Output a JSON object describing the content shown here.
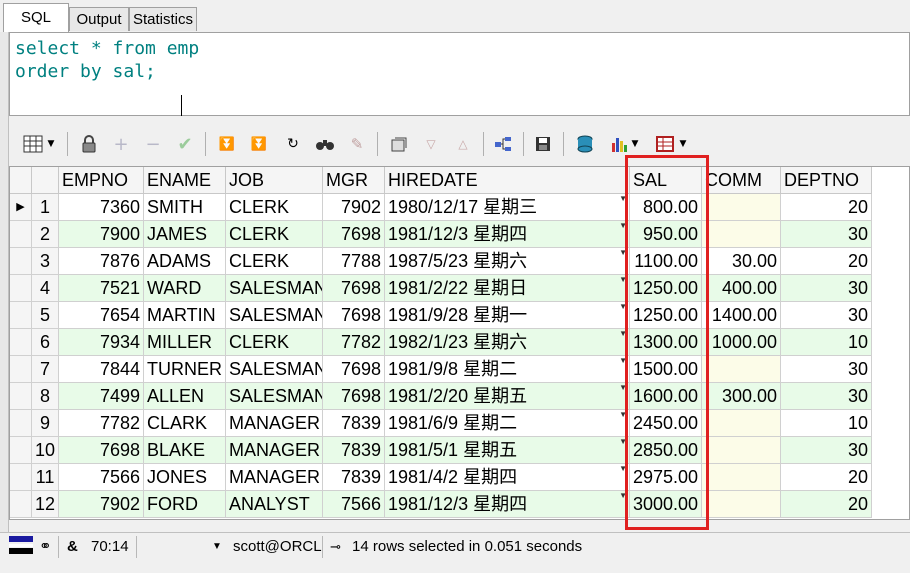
{
  "tabs": [
    {
      "label": "SQL",
      "active": true
    },
    {
      "label": "Output",
      "active": false
    },
    {
      "label": "Statistics",
      "active": false
    }
  ],
  "editor": {
    "line1": "select * from emp",
    "line2": "order by sal;"
  },
  "grid": {
    "columns": [
      "EMPNO",
      "ENAME",
      "JOB",
      "MGR",
      "HIREDATE",
      "SAL",
      "COMM",
      "DEPTNO"
    ],
    "rows": [
      {
        "n": "1",
        "empno": "7360",
        "ename": "SMITH",
        "job": "CLERK",
        "mgr": "7902",
        "hiredate": "1980/12/17 星期三",
        "sal": "800.00",
        "comm": "",
        "deptno": "20"
      },
      {
        "n": "2",
        "empno": "7900",
        "ename": "JAMES",
        "job": "CLERK",
        "mgr": "7698",
        "hiredate": "1981/12/3 星期四",
        "sal": "950.00",
        "comm": "",
        "deptno": "30"
      },
      {
        "n": "3",
        "empno": "7876",
        "ename": "ADAMS",
        "job": "CLERK",
        "mgr": "7788",
        "hiredate": "1987/5/23 星期六",
        "sal": "1100.00",
        "comm": "30.00",
        "deptno": "20"
      },
      {
        "n": "4",
        "empno": "7521",
        "ename": "WARD",
        "job": "SALESMAN",
        "mgr": "7698",
        "hiredate": "1981/2/22 星期日",
        "sal": "1250.00",
        "comm": "400.00",
        "deptno": "30"
      },
      {
        "n": "5",
        "empno": "7654",
        "ename": "MARTIN",
        "job": "SALESMAN",
        "mgr": "7698",
        "hiredate": "1981/9/28 星期一",
        "sal": "1250.00",
        "comm": "1400.00",
        "deptno": "30"
      },
      {
        "n": "6",
        "empno": "7934",
        "ename": "MILLER",
        "job": "CLERK",
        "mgr": "7782",
        "hiredate": "1982/1/23 星期六",
        "sal": "1300.00",
        "comm": "1000.00",
        "deptno": "10"
      },
      {
        "n": "7",
        "empno": "7844",
        "ename": "TURNER",
        "job": "SALESMAN",
        "mgr": "7698",
        "hiredate": "1981/9/8 星期二",
        "sal": "1500.00",
        "comm": "",
        "deptno": "30"
      },
      {
        "n": "8",
        "empno": "7499",
        "ename": "ALLEN",
        "job": "SALESMAN",
        "mgr": "7698",
        "hiredate": "1981/2/20 星期五",
        "sal": "1600.00",
        "comm": "300.00",
        "deptno": "30"
      },
      {
        "n": "9",
        "empno": "7782",
        "ename": "CLARK",
        "job": "MANAGER",
        "mgr": "7839",
        "hiredate": "1981/6/9 星期二",
        "sal": "2450.00",
        "comm": "",
        "deptno": "10"
      },
      {
        "n": "10",
        "empno": "7698",
        "ename": "BLAKE",
        "job": "MANAGER",
        "mgr": "7839",
        "hiredate": "1981/5/1 星期五",
        "sal": "2850.00",
        "comm": "",
        "deptno": "30"
      },
      {
        "n": "11",
        "empno": "7566",
        "ename": "JONES",
        "job": "MANAGER",
        "mgr": "7839",
        "hiredate": "1981/4/2 星期四",
        "sal": "2975.00",
        "comm": "",
        "deptno": "20"
      },
      {
        "n": "12",
        "empno": "7902",
        "ename": "FORD",
        "job": "ANALYST",
        "mgr": "7566",
        "hiredate": "1981/12/3 星期四",
        "sal": "3000.00",
        "comm": "",
        "deptno": "20"
      }
    ]
  },
  "status": {
    "cursor": "70:14",
    "connection": "scott@ORCL",
    "message": "14 rows selected in 0.051 seconds"
  },
  "colors": {
    "keyword": "#008080",
    "alt_row": "#e8fbe8",
    "highlight_box": "#e02020"
  }
}
